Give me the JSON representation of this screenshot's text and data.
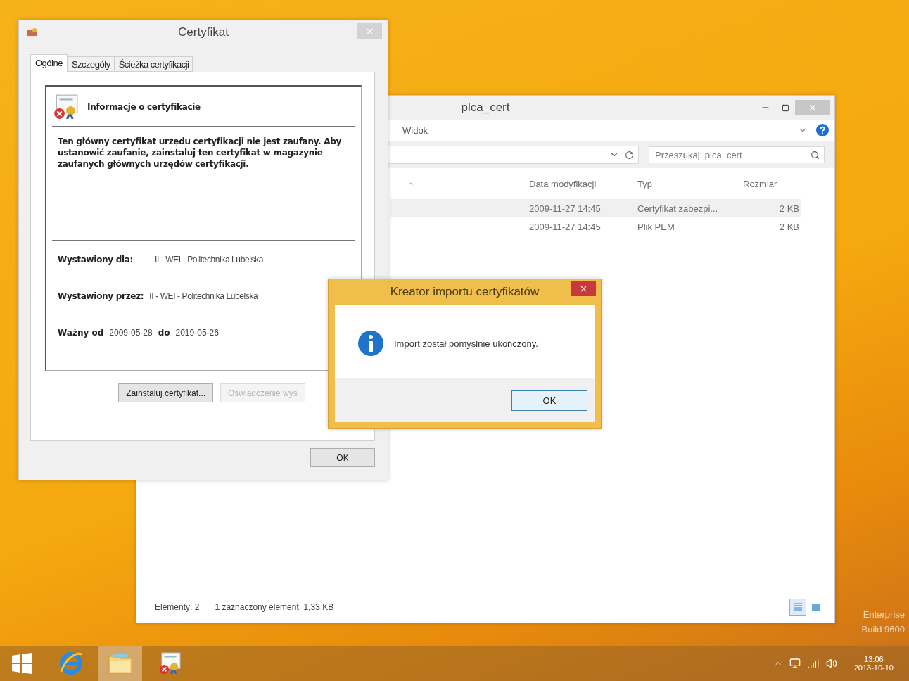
{
  "explorer": {
    "title": "plca_cert",
    "ribbon_tab": "Widok",
    "search": {
      "placeholder": "Przeszukaj: plca_cert"
    },
    "columns": [
      "Data modyfikacji",
      "Typ",
      "Rozmiar"
    ],
    "rows": [
      {
        "date": "2009-11-27 14:45",
        "type": "Certyfikat zabezpi...",
        "size": "2 KB",
        "selected": true
      },
      {
        "date": "2009-11-27 14:45",
        "type": "Plik PEM",
        "size": "2 KB",
        "selected": false
      }
    ],
    "status": {
      "items": "Elementy: 2",
      "selection": "1 zaznaczony element, 1,33 KB"
    },
    "view_buttons": [
      {
        "kind": "details",
        "selected": true
      },
      {
        "kind": "large-icons",
        "selected": false
      }
    ]
  },
  "certificate_window": {
    "title": "Certyfikat",
    "tabs": [
      {
        "label": "Ogólne",
        "selected": true
      },
      {
        "label": "Szczegóły",
        "selected": false
      },
      {
        "label": "Ścieżka certyfikacji",
        "selected": false
      }
    ],
    "heading": "Informacje o certyfikacie",
    "message": "Ten główny certyfikat urzędu certyfikacji nie jest zaufany. Aby ustanowić zaufanie, zainstaluj ten certyfikat w magazynie zaufanych głównych urzędów certyfikacji.",
    "fields": [
      {
        "label": "Wystawiony dla:",
        "value": "II - WEI - Politechnika Lubelska"
      },
      {
        "label": "Wystawiony przez:",
        "value": "II - WEI - Politechnika Lubelska"
      }
    ],
    "validity": {
      "from_label": "Ważny od",
      "from": "2009-05-28",
      "to_label": "do",
      "to": "2019-05-26"
    },
    "buttons": [
      {
        "label": "Zainstaluj certyfikat...",
        "disabled": false
      },
      {
        "label": "Oświadczenie wys",
        "disabled": true
      }
    ],
    "ok": "OK"
  },
  "import_dialog": {
    "title": "Kreator importu certyfikatów",
    "message": "Import został pomyślnie ukończony.",
    "ok": "OK"
  },
  "desktop": {
    "edition": "Enterprise",
    "build": "Build 9600"
  },
  "taskbar": {
    "items": [
      {
        "kind": "start",
        "selected": false
      },
      {
        "kind": "browser",
        "selected": false
      },
      {
        "kind": "folder",
        "selected": true
      },
      {
        "kind": "certificate",
        "selected": false
      }
    ],
    "time": "13:06",
    "date": "2013-10-10"
  }
}
